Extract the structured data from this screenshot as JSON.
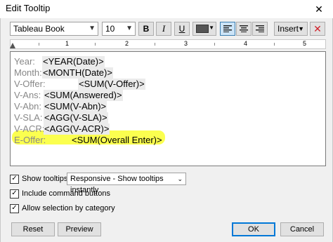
{
  "window": {
    "title": "Edit Tooltip",
    "close_glyph": "✕"
  },
  "toolbar": {
    "font_family": "Tableau Book",
    "font_size": "10",
    "bold_label": "B",
    "italic_label": "I",
    "underline_label": "U",
    "text_color": "#555555",
    "insert_label": "Insert",
    "clear_glyph": "✕"
  },
  "ruler": {
    "labels": [
      "1",
      "2",
      "3",
      "4",
      "5"
    ]
  },
  "tooltip_lines": [
    {
      "label": "Year:",
      "value": "<YEAR(Date)>"
    },
    {
      "label": "Month:",
      "value": "<MONTH(Date)>"
    },
    {
      "label": "V-Offer:",
      "value": "<SUM(V-Offer)>"
    },
    {
      "label": "V-Ans:",
      "value": "<SUM(Answered)>"
    },
    {
      "label": "V-Abn:",
      "value": "<SUM(V-Abn)>"
    },
    {
      "label": "V-SLA:",
      "value": "<AGG(V-SLA)>"
    },
    {
      "label": "V-ACR:",
      "value": "<AGG(V-ACR)>"
    },
    {
      "label": "E-Offer:",
      "value": "<SUM(Overall Enter)>"
    }
  ],
  "highlight_color": "#fbff3c",
  "options": {
    "show_tooltips": {
      "label": "Show tooltips",
      "checked": true
    },
    "tooltip_mode": "Responsive - Show tooltips instantly",
    "include_command_buttons": {
      "label": "Include command buttons",
      "checked": true
    },
    "allow_selection": {
      "label": "Allow selection by category",
      "checked": true
    }
  },
  "buttons": {
    "reset": "Reset",
    "preview": "Preview",
    "ok": "OK",
    "cancel": "Cancel"
  }
}
